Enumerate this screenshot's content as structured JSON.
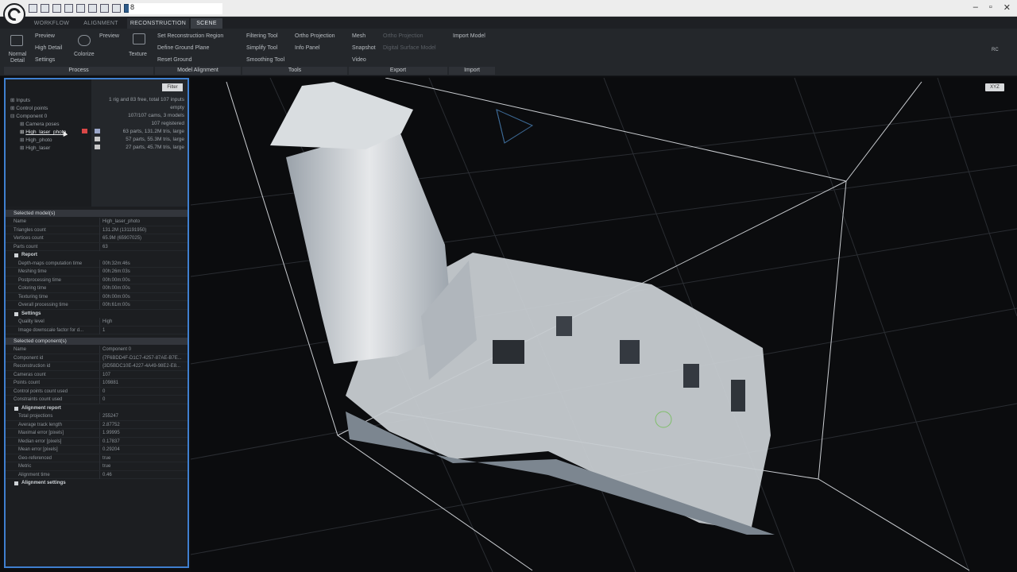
{
  "window": {
    "title": "8",
    "controls": [
      "–",
      "▫",
      "✕"
    ]
  },
  "tabs": [
    "WORKFLOW",
    "ALIGNMENT",
    "RECONSTRUCTION",
    "SCENE"
  ],
  "ribbon": {
    "normal_detail": "Normal Detail",
    "preview_a": "Preview",
    "high_detail": "High Detail",
    "settings": "Settings",
    "preview_b": "Preview",
    "colorize": "Colorize",
    "texture": "Texture",
    "set_region": "Set Reconstruction Region",
    "define_ground": "Define Ground Plane",
    "reset_ground": "Reset Ground",
    "filtering": "Filtering Tool",
    "simplify": "Simplify Tool",
    "smoothing": "Smoothing Tool",
    "ortho": "Ortho Projection",
    "info_panel": "Info Panel",
    "mesh": "Mesh",
    "snapshot": "Snapshot",
    "video": "Video",
    "ortho_proj_dim": "Ortho Projection",
    "dsm": "Digital Surface Model",
    "import_model": "Import Model",
    "groups": [
      "Process",
      "Model Alignment",
      "Tools",
      "Export",
      "Import"
    ]
  },
  "tree": {
    "nodes": [
      "Inputs",
      "Control points",
      "Component 0",
      "Camera poses",
      "High_laser_photo",
      "High_photo",
      "High_laser"
    ],
    "info": [
      "1 rig and 83 free, total 107 inputs",
      "empty",
      "107/107 cams, 3 models",
      "107 registered",
      "63 parts, 131.2M tris, large",
      "57 parts, 55.3M tris, large",
      "27 parts, 45.7M tris, large"
    ],
    "filter_button": "Filter"
  },
  "selected_model": {
    "header": "Selected model(s)",
    "rows": [
      {
        "k": "Name",
        "v": "High_laser_photo"
      },
      {
        "k": "Triangles count",
        "v": "131.2M (131191950)"
      },
      {
        "k": "Vertices count",
        "v": "65.9M (65907025)"
      },
      {
        "k": "Parts count",
        "v": "63"
      }
    ],
    "report_header": "Report",
    "report_rows": [
      {
        "k": "Depth-maps computation time",
        "v": "00h:32m:46s"
      },
      {
        "k": "Meshing time",
        "v": "00h:26m:03s"
      },
      {
        "k": "Postprocessing time",
        "v": "00h:00m:00s"
      },
      {
        "k": "Coloring time",
        "v": "00h:00m:00s"
      },
      {
        "k": "Texturing time",
        "v": "00h:00m:00s"
      },
      {
        "k": "Overall processing time",
        "v": "00h:61m:00s"
      }
    ],
    "settings_header": "Settings",
    "settings_rows": [
      {
        "k": "Quality level",
        "v": "High"
      },
      {
        "k": "Image downscale factor for d...",
        "v": "1"
      }
    ]
  },
  "selected_component": {
    "header": "Selected component(s)",
    "rows": [
      {
        "k": "Name",
        "v": "Component 0"
      },
      {
        "k": "Component id",
        "v": "{7F6BDD4F-D1C7-4257-87AE-B7E..."
      },
      {
        "k": "Reconstruction id",
        "v": "{3D5BDC10E-4227-4A49-98E2-E8..."
      },
      {
        "k": "Cameras count",
        "v": "107"
      },
      {
        "k": "Points count",
        "v": "109881"
      },
      {
        "k": "Control points count used",
        "v": "0"
      },
      {
        "k": "Constraints count used",
        "v": "0"
      }
    ],
    "alignment_header": "Alignment report",
    "alignment_rows": [
      {
        "k": "Total projections",
        "v": "255247"
      },
      {
        "k": "Average track length",
        "v": "2.87752"
      },
      {
        "k": "Maximal error [pixels]",
        "v": "1.99995"
      },
      {
        "k": "Median error [pixels]",
        "v": "0.17837"
      },
      {
        "k": "Mean error [pixels]",
        "v": "0.29204"
      },
      {
        "k": "Geo-referenced",
        "v": "true"
      },
      {
        "k": "Metric",
        "v": "true"
      },
      {
        "k": "Alignment time",
        "v": "0.46"
      }
    ],
    "alignment_settings": "Alignment settings"
  },
  "viewport": {
    "button": "XYZ"
  },
  "colors": {
    "accent": "#3f7fcf",
    "badge": "#d94747"
  }
}
